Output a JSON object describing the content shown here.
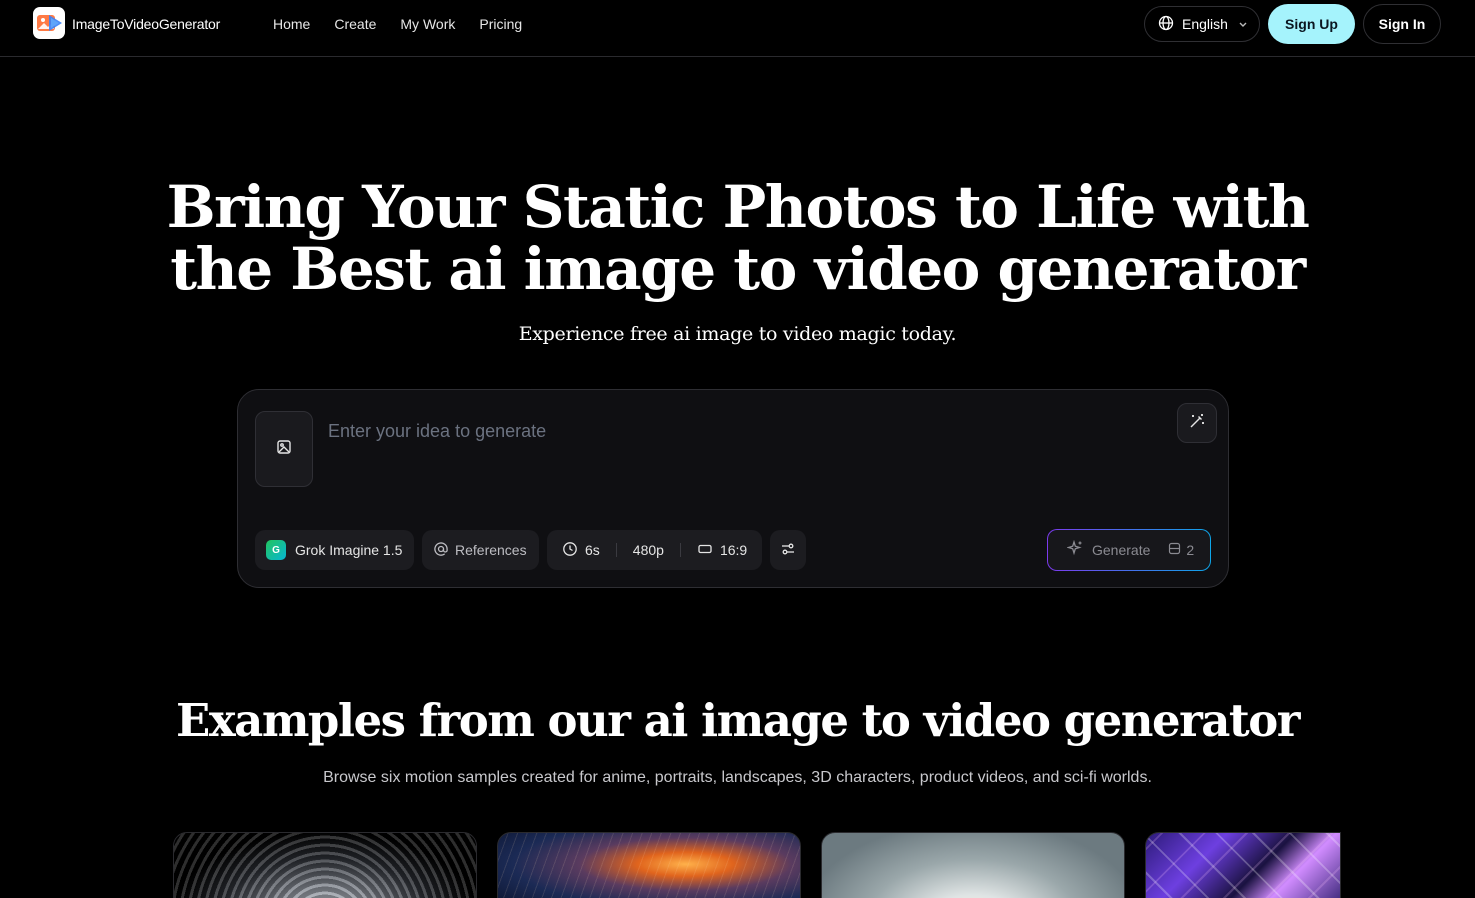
{
  "nav": {
    "brand": "ImageToVideoGenerator",
    "links": [
      "Home",
      "Create",
      "My Work",
      "Pricing"
    ],
    "language": "English",
    "sign_up": "Sign Up",
    "sign_in": "Sign In"
  },
  "hero": {
    "title_line1": "Bring Your Static Photos to Life with",
    "title_line2": "the Best ai image to video generator",
    "subtitle": "Experience free ai image to video magic today."
  },
  "composer": {
    "placeholder": "Enter your idea to generate",
    "model_badge": "G",
    "model": "Grok Imagine 1.5",
    "references": "References",
    "duration": "6s",
    "resolution": "480p",
    "aspect_ratio": "16:9",
    "generate": "Generate",
    "credits": "2"
  },
  "examples": {
    "title": "Examples from our ai image to video generator",
    "subtitle": "Browse six motion samples created for anime, portraits, landscapes, 3D characters, product videos, and sci-fi worlds."
  },
  "colors": {
    "accent": "#a5f3fc",
    "background": "#000000",
    "card": "#0f0f12"
  },
  "icons": {
    "language": "globe-icon",
    "upload": "image-icon",
    "magic": "magic-wand-icon",
    "references": "at-sign-icon",
    "duration": "clock-icon",
    "aspect": "rectangle-icon",
    "settings": "sliders-icon",
    "generate": "sparkle-icon",
    "credits": "coins-icon"
  }
}
